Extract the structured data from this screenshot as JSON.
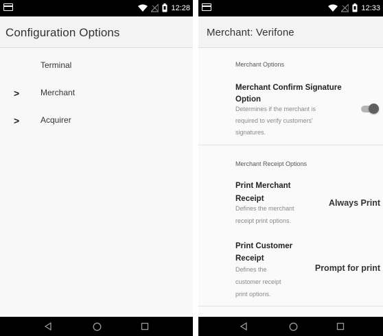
{
  "left_screen": {
    "status_bar": {
      "time": "12:28"
    },
    "app_bar": {
      "title": "Configuration Options"
    },
    "items": [
      {
        "label": "Terminal",
        "has_chevron": false
      },
      {
        "label": "Merchant",
        "has_chevron": true
      },
      {
        "label": "Acquirer",
        "has_chevron": true
      }
    ],
    "chevron_glyph": ">"
  },
  "right_screen": {
    "status_bar": {
      "time": "12:33"
    },
    "app_bar": {
      "title": "Merchant: Verifone"
    },
    "merchant_options": {
      "header": "Merchant Options",
      "confirm_signature": {
        "title_line1": "Merchant Confirm Signature",
        "title_line2": "Option",
        "desc_line1": "Determines if the merchant is",
        "desc_line2": "required to verify customers'",
        "desc_line3": "signatures.",
        "enabled": true
      }
    },
    "receipt_options": {
      "header": "Merchant Receipt Options",
      "print_merchant": {
        "title_line1": "Print Merchant",
        "title_line2": "Receipt",
        "desc_line1": "Defines the merchant",
        "desc_line2": "receipt print options.",
        "value": "Always Print"
      },
      "print_customer": {
        "title_line1": "Print Customer",
        "title_line2": "Receipt",
        "desc_line1": "Defines the",
        "desc_line2": "customer receipt",
        "desc_line3": "print options.",
        "value": "Prompt for print"
      }
    }
  },
  "colors": {
    "status_bar": "#000000",
    "app_bar": "#f3f3f3",
    "toggle_knob": "#5f5f5f",
    "toggle_track": "#b5b5b5"
  },
  "icons": [
    "window-icon",
    "wifi-icon",
    "no-signal-icon",
    "battery-icon",
    "back-icon",
    "home-icon",
    "recents-icon",
    "chevron-right-icon",
    "toggle-switch"
  ]
}
